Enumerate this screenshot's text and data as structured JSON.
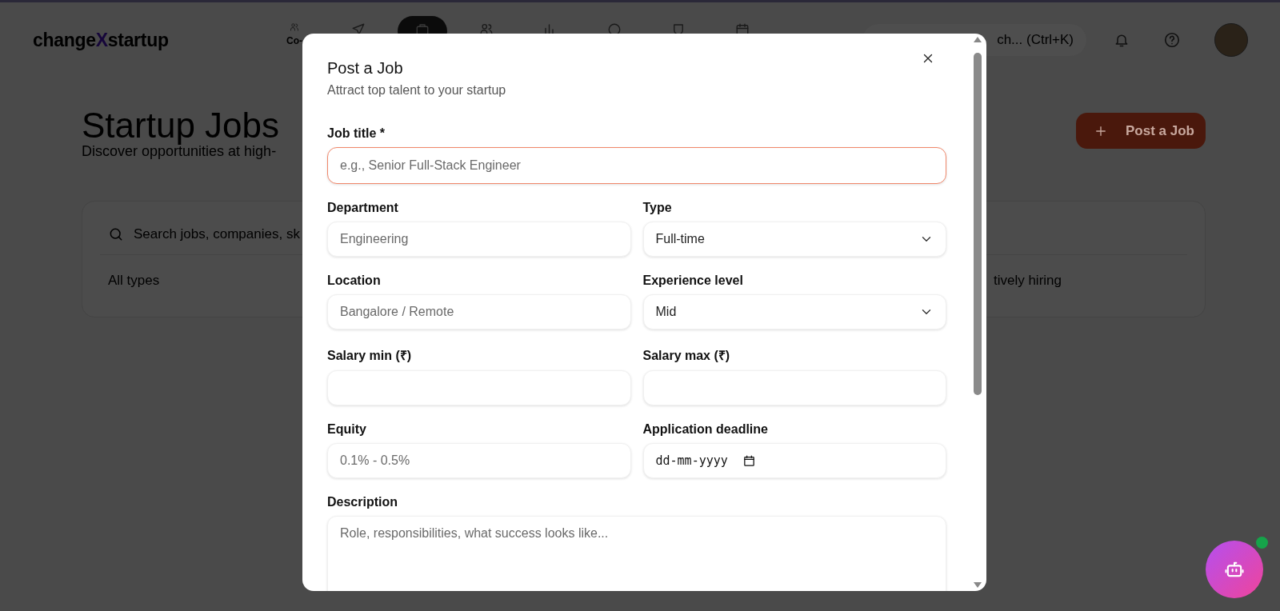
{
  "header": {
    "logo": {
      "prefix": "change",
      "highlight": "X",
      "suffix": "startup"
    },
    "nav": [
      {
        "label": "Co-",
        "selected": false
      },
      {
        "selected": false
      },
      {
        "selected": true
      },
      {
        "selected": false
      },
      {
        "selected": false
      },
      {
        "selected": false
      },
      {
        "selected": false
      },
      {
        "selected": false
      }
    ],
    "search": {
      "placeholder": "ch... (Ctrl+K)"
    }
  },
  "page": {
    "title": "Startup Jobs",
    "subtitle": "Discover opportunities at high-",
    "post_button": "Post a Job",
    "filters": {
      "search_placeholder": "Search jobs, companies, sk",
      "type_filter": "All types",
      "hiring_label": "tively hiring"
    }
  },
  "modal": {
    "title": "Post a Job",
    "subtitle": "Attract top talent to your startup",
    "fields": [
      {
        "kind": "text",
        "label": "Job title *",
        "placeholder": "e.g., Senior Full-Stack Engineer",
        "focused": true
      },
      {
        "kind": "text",
        "label": "Department",
        "placeholder": "Engineering",
        "focused": false
      },
      {
        "kind": "select",
        "label": "Type",
        "value": "Full-time",
        "focused": false
      },
      {
        "kind": "text",
        "label": "Location",
        "placeholder": "Bangalore / Remote",
        "focused": false
      },
      {
        "kind": "select",
        "label": "Experience level",
        "value": "Mid",
        "focused": false
      },
      {
        "kind": "text",
        "label": "Salary min (₹)",
        "focused": false
      },
      {
        "kind": "text",
        "label": "Salary max (₹)",
        "focused": false
      },
      {
        "kind": "text",
        "label": "Equity",
        "placeholder": "0.1% - 0.5%",
        "focused": false
      },
      {
        "kind": "date",
        "label": "Application deadline",
        "value": "dd-mm-yyyy",
        "focused": false
      },
      {
        "kind": "textarea",
        "label": "Description",
        "placeholder": "Role, responsibilities, what success looks like...",
        "focused": false
      }
    ]
  }
}
